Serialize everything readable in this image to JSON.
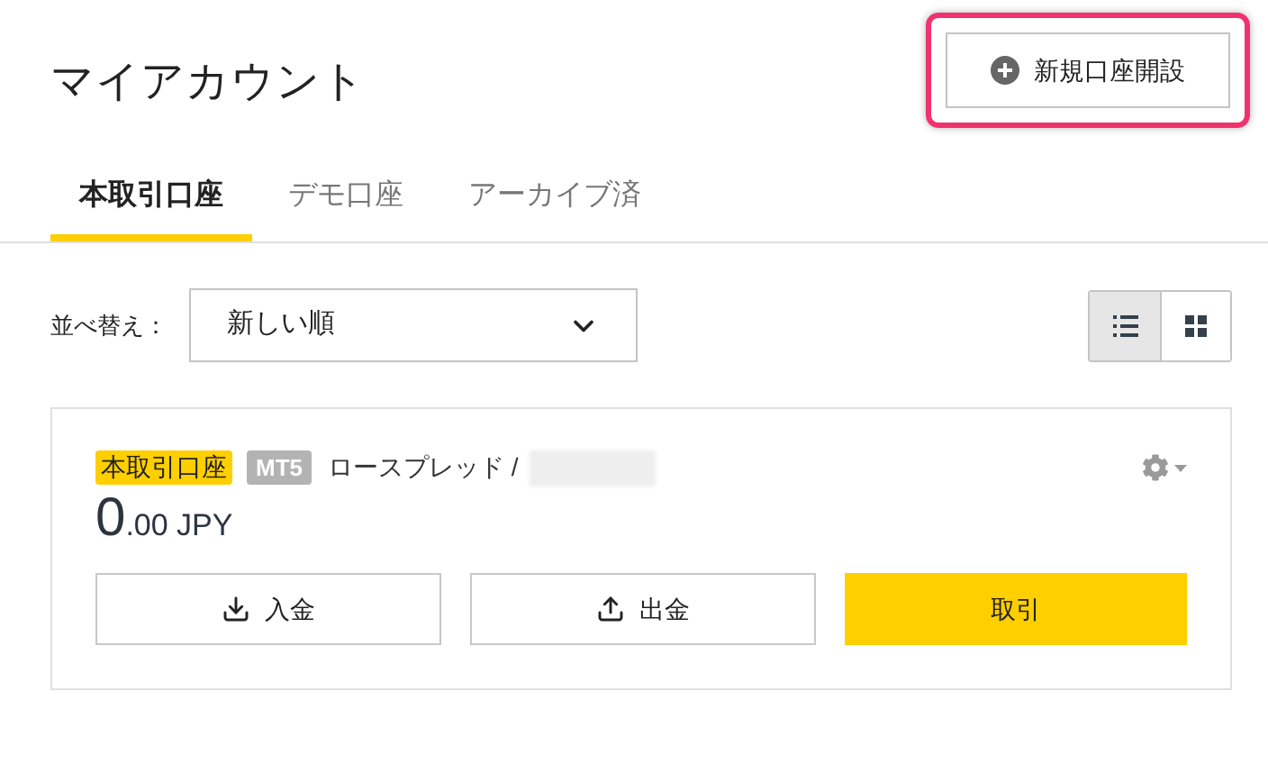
{
  "header": {
    "title": "マイアカウント",
    "new_account_button": {
      "label": "新規口座開設",
      "highlighted": true
    }
  },
  "tabs": [
    {
      "label": "本取引口座",
      "selected": true
    },
    {
      "label": "デモ口座",
      "selected": false
    },
    {
      "label": "アーカイブ済",
      "selected": false
    }
  ],
  "sort": {
    "label": "並べ替え：",
    "value": "新しい順"
  },
  "view_toggle": [
    {
      "kind": "list",
      "selected": true
    },
    {
      "kind": "grid",
      "selected": false
    }
  ],
  "accounts": [
    {
      "type_badge": "本取引口座",
      "platform_badge": "MT5",
      "account_name": "ロースプレッド /",
      "balance_integer": "0",
      "balance_rest": ".00 JPY",
      "actions": [
        {
          "kind": "deposit",
          "label": "入金"
        },
        {
          "kind": "withdraw",
          "label": "出金"
        },
        {
          "kind": "trade",
          "label": "取引"
        }
      ]
    }
  ]
}
